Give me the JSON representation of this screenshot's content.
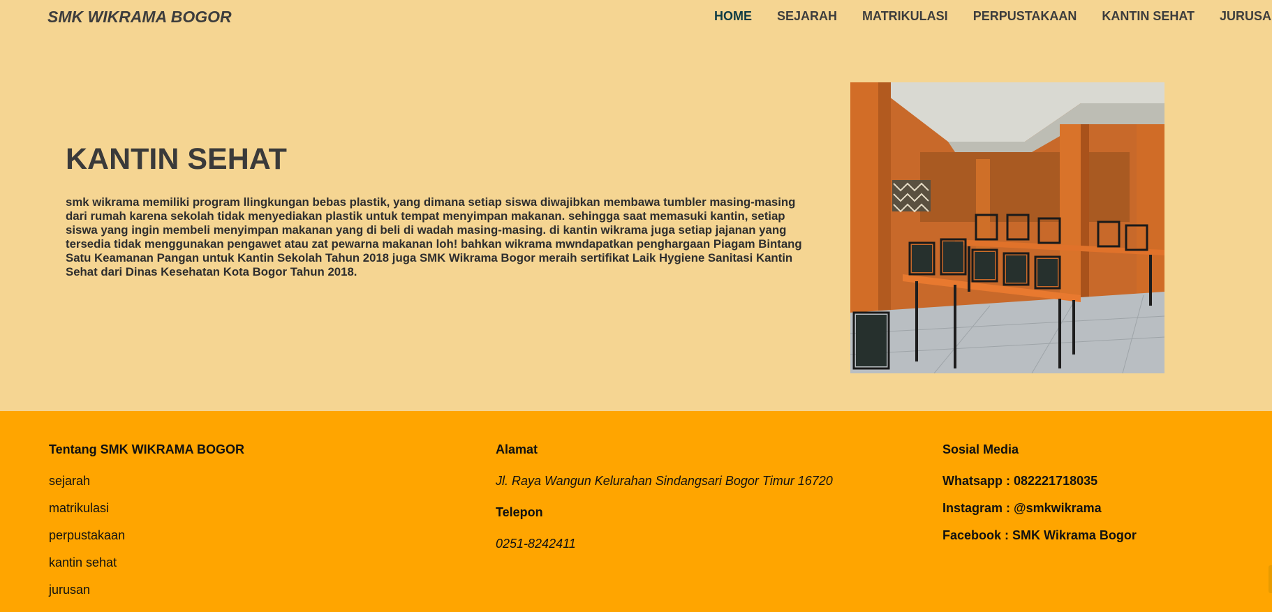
{
  "nav": {
    "brand": "SMK WIKRAMA BOGOR",
    "links": [
      "HOME",
      "SEJARAH",
      "MATRIKULASI",
      "PERPUSTAKAAN",
      "KANTIN SEHAT",
      "JURUSA"
    ]
  },
  "hero": {
    "title": "KANTIN SEHAT",
    "paragraph": "smk wikrama memiliki program llingkungan bebas plastik, yang dimana setiap siswa diwajibkan membawa tumbler masing-masing dari rumah karena sekolah tidak menyediakan plastik untuk tempat menyimpan makanan. sehingga saat memasuki kantin, setiap siswa yang ingin membeli menyimpan makanan yang di beli di wadah masing-masing. di kantin wikrama juga setiap jajanan yang tersedia tidak menggunakan pengawet atau zat pewarna makanan loh! bahkan wikrama mwndapatkan penghargaan Piagam Bintang Satu Keamanan Pangan untuk Kantin Sekolah Tahun 2018 juga SMK Wikrama Bogor meraih sertifikat Laik Hygiene Sanitasi Kantin Sehat dari Dinas Kesehatan Kota Bogor Tahun 2018."
  },
  "footer": {
    "about": {
      "heading": "Tentang SMK WIKRAMA BOGOR",
      "links": [
        "sejarah",
        "matrikulasi",
        "perpustakaan",
        "kantin sehat",
        "jurusan"
      ]
    },
    "address": {
      "heading": "Alamat",
      "value": "Jl. Raya Wangun Kelurahan Sindangsari Bogor Timur 16720",
      "phone_heading": "Telepon",
      "phone": "0251-8242411"
    },
    "social": {
      "heading": "Sosial Media",
      "items": [
        "Whatsapp : 082221718035",
        "Instagram : @smkwikrama",
        "Facebook : SMK Wikrama Bogor"
      ]
    }
  },
  "colors": {
    "page_bg": "#f5d592",
    "footer_bg": "#ffa500",
    "nav_active": "#0d3b44"
  }
}
